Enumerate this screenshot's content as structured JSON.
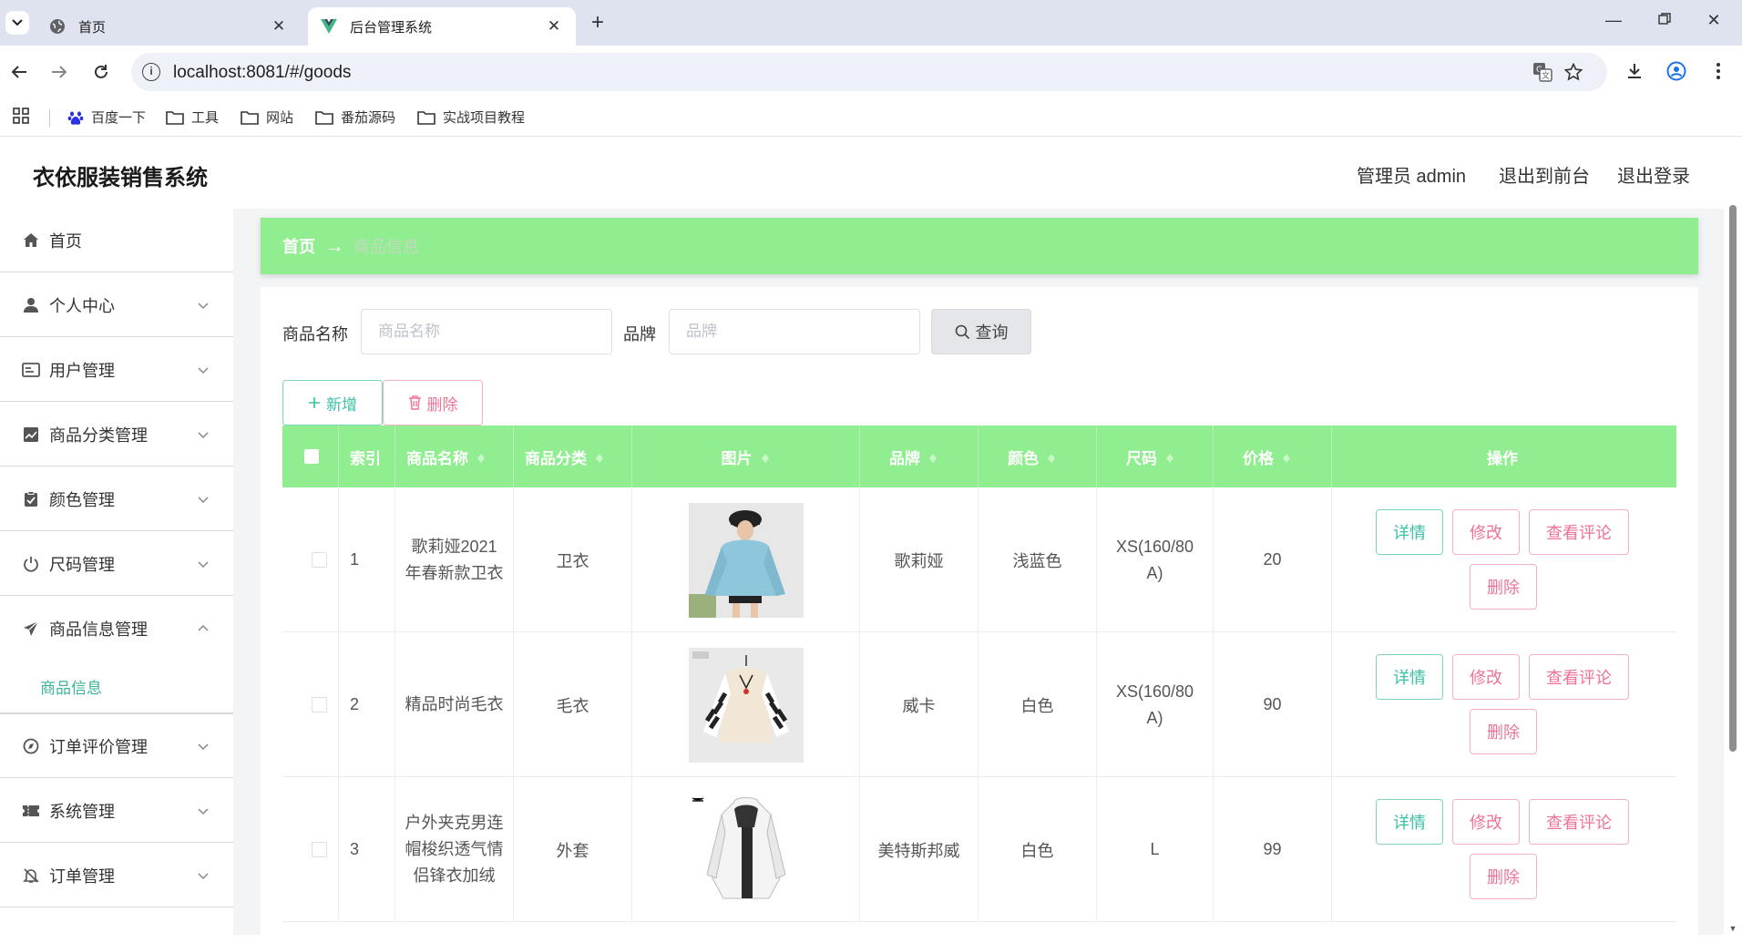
{
  "browser": {
    "tabs": [
      {
        "label": "首页",
        "active": false
      },
      {
        "label": "后台管理系统",
        "active": true
      }
    ],
    "url": "localhost:8081/#/goods",
    "bookmarks": [
      "百度一下",
      "工具",
      "网站",
      "番茄源码",
      "实战项目教程"
    ]
  },
  "app": {
    "title": "衣依服装销售系统",
    "header_links": [
      "管理员 admin",
      "退出到前台",
      "退出登录"
    ]
  },
  "sidebar": {
    "items": [
      {
        "label": "首页",
        "icon": "home-icon"
      },
      {
        "label": "个人中心",
        "icon": "user-icon"
      },
      {
        "label": "用户管理",
        "icon": "id-card-icon"
      },
      {
        "label": "商品分类管理",
        "icon": "chart-icon"
      },
      {
        "label": "颜色管理",
        "icon": "clipboard-check-icon"
      },
      {
        "label": "尺码管理",
        "icon": "power-icon"
      },
      {
        "label": "商品信息管理",
        "icon": "send-icon",
        "expanded": true
      },
      {
        "label": "订单评价管理",
        "icon": "compass-icon"
      },
      {
        "label": "系统管理",
        "icon": "ticket-icon"
      },
      {
        "label": "订单管理",
        "icon": "bell-off-icon"
      }
    ],
    "submenu": [
      "商品信息"
    ]
  },
  "breadcrumb": {
    "home": "首页",
    "separator": "→",
    "current": "商品信息"
  },
  "search": {
    "name_label": "商品名称",
    "name_placeholder": "商品名称",
    "brand_label": "品牌",
    "brand_placeholder": "品牌",
    "query_button": "查询"
  },
  "actions": {
    "add": "新增",
    "delete": "删除"
  },
  "table": {
    "columns": [
      "索引",
      "商品名称",
      "商品分类",
      "图片",
      "品牌",
      "颜色",
      "尺码",
      "价格",
      "操作"
    ],
    "rows": [
      {
        "index": "1",
        "name": "歌莉娅2021年春新款卫衣",
        "category": "卫衣",
        "brand": "歌莉娅",
        "color": "浅蓝色",
        "size": "XS(160/80A)",
        "price": "20"
      },
      {
        "index": "2",
        "name": "精品时尚毛衣",
        "category": "毛衣",
        "brand": "威卡",
        "color": "白色",
        "size": "XS(160/80A)",
        "price": "90"
      },
      {
        "index": "3",
        "name": "户外夹克男连帽梭织透气情侣锋衣加绒",
        "category": "外套",
        "brand": "美特斯邦威",
        "color": "白色",
        "size": "L",
        "price": "99"
      }
    ],
    "row_actions": {
      "detail": "详情",
      "edit": "修改",
      "comments": "查看评论",
      "delete": "删除"
    }
  },
  "colors": {
    "accent_green": "#90ee90",
    "teal": "#3cc0a6",
    "pink": "#ef7396"
  }
}
